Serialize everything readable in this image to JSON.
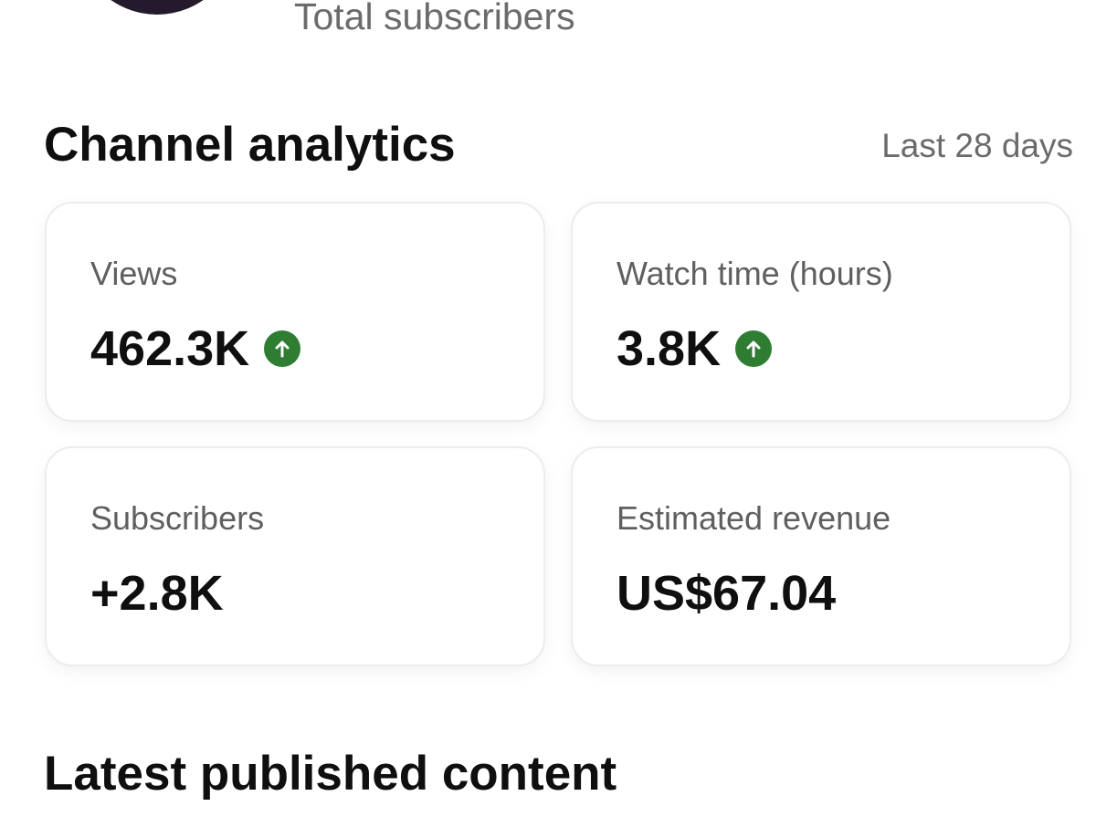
{
  "header": {
    "total_subscribers_label": "Total subscribers"
  },
  "analytics": {
    "title": "Channel analytics",
    "range_label": "Last 28 days",
    "cards": [
      {
        "label": "Views",
        "value": "462.3K",
        "trend": "up"
      },
      {
        "label": "Watch time (hours)",
        "value": "3.8K",
        "trend": "up"
      },
      {
        "label": "Subscribers",
        "value": "+2.8K"
      },
      {
        "label": "Estimated revenue",
        "value": "US$67.04"
      }
    ]
  },
  "latest": {
    "title": "Latest published content"
  },
  "icons": {
    "trend_up": "arrow-up-circle-icon"
  },
  "colors": {
    "trend_up": "#2e7d32",
    "secondary_text": "#606060",
    "primary_text": "#0f0f0f",
    "avatar": "#251a2b"
  }
}
